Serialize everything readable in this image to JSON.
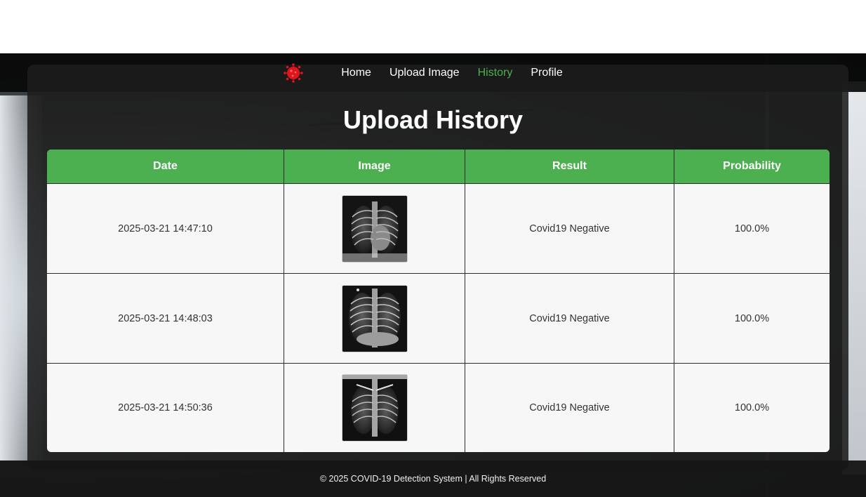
{
  "nav": {
    "logo_icon": "virus-icon",
    "items": [
      {
        "label": "Home",
        "active": false
      },
      {
        "label": "Upload Image",
        "active": false
      },
      {
        "label": "History",
        "active": true
      },
      {
        "label": "Profile",
        "active": false
      }
    ]
  },
  "page": {
    "title": "Upload History"
  },
  "table": {
    "headers": [
      "Date",
      "Image",
      "Result",
      "Probability"
    ],
    "rows": [
      {
        "date": "2025-03-21 14:47:10",
        "image": "chest-xray-thumbnail",
        "result": "Covid19 Negative",
        "probability": "100.0%"
      },
      {
        "date": "2025-03-21 14:48:03",
        "image": "chest-xray-thumbnail",
        "result": "Covid19 Negative",
        "probability": "100.0%"
      },
      {
        "date": "2025-03-21 14:50:36",
        "image": "chest-xray-thumbnail",
        "result": "Covid19 Negative",
        "probability": "100.0%"
      }
    ]
  },
  "footer": {
    "text": "© 2025 COVID-19 Detection System | All Rights Reserved"
  },
  "colors": {
    "accent": "#4caf50",
    "nav_bg": "#080808",
    "panel_bg": "#1c1c1c",
    "table_bg": "#f7f7f7",
    "logo_red": "#e0141e"
  }
}
